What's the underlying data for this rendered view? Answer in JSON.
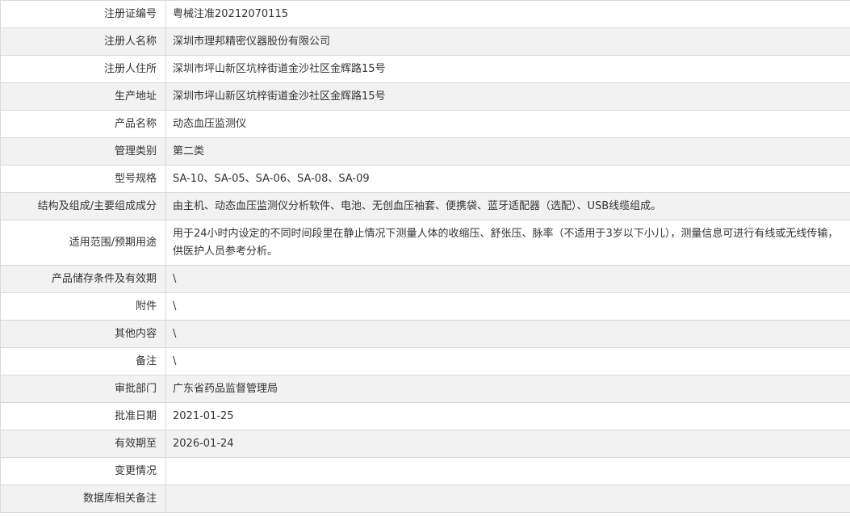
{
  "rows": [
    {
      "label": "注册证编号",
      "value": "粤械注准20212070115"
    },
    {
      "label": "注册人名称",
      "value": "深圳市理邦精密仪器股份有限公司"
    },
    {
      "label": "注册人住所",
      "value": "深圳市坪山新区坑梓街道金沙社区金辉路15号"
    },
    {
      "label": "生产地址",
      "value": "深圳市坪山新区坑梓街道金沙社区金辉路15号"
    },
    {
      "label": "产品名称",
      "value": "动态血压监测仪"
    },
    {
      "label": "管理类别",
      "value": "第二类"
    },
    {
      "label": "型号规格",
      "value": "SA-10、SA-05、SA-06、SA-08、SA-09"
    },
    {
      "label": "结构及组成/主要组成成分",
      "value": "由主机、动态血压监测仪分析软件、电池、无创血压袖套、便携袋、蓝牙适配器（选配）、USB线缆组成。"
    },
    {
      "label": "适用范围/预期用途",
      "value": "用于24小时内设定的不同时间段里在静止情况下测量人体的收缩压、舒张压、脉率（不适用于3岁以下小儿），测量信息可进行有线或无线传输，供医护人员参考分析。"
    },
    {
      "label": "产品储存条件及有效期",
      "value": "\\"
    },
    {
      "label": "附件",
      "value": "\\"
    },
    {
      "label": "其他内容",
      "value": "\\"
    },
    {
      "label": "备注",
      "value": "\\"
    },
    {
      "label": "审批部门",
      "value": "广东省药品监督管理局"
    },
    {
      "label": "批准日期",
      "value": "2021-01-25"
    },
    {
      "label": "有效期至",
      "value": "2026-01-24"
    },
    {
      "label": "变更情况",
      "value": ""
    },
    {
      "label": "数据库相关备注",
      "value": ""
    }
  ]
}
